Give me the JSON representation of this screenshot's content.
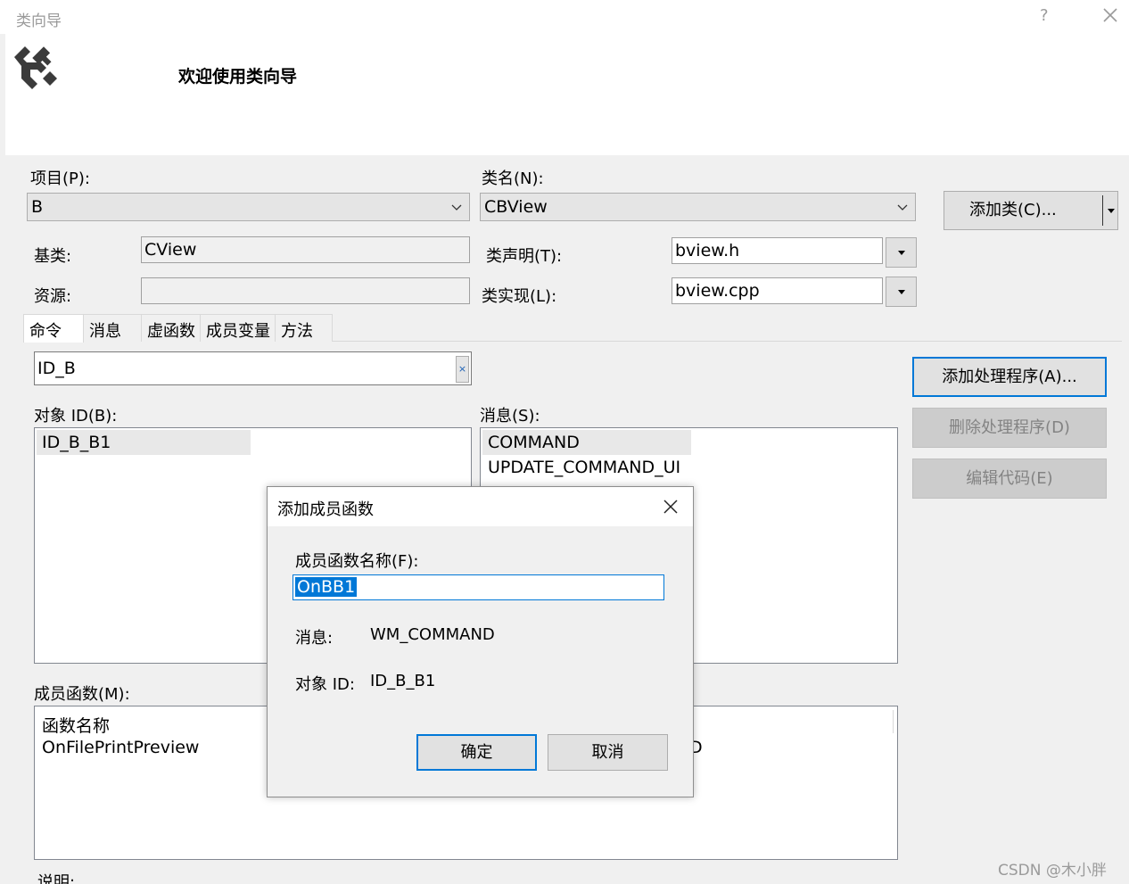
{
  "window": {
    "title": "类向导",
    "help_glyph": "?",
    "welcome": "欢迎使用类向导"
  },
  "project": {
    "label": "项目(P):",
    "value": "B"
  },
  "class_name": {
    "label": "类名(N):",
    "value": "CBView"
  },
  "add_class_button": "添加类(C)...",
  "base_class": {
    "label": "基类:",
    "value": "CView"
  },
  "resource": {
    "label": "资源:",
    "value": ""
  },
  "class_decl": {
    "label": "类声明(T):",
    "value": "bview.h"
  },
  "class_impl": {
    "label": "类实现(L):",
    "value": "bview.cpp"
  },
  "tabs": [
    "命令",
    "消息",
    "虚函数",
    "成员变量",
    "方法"
  ],
  "search": {
    "value": "ID_B",
    "clear_glyph": "×"
  },
  "object_ids": {
    "label": "对象 ID(B):",
    "items": [
      "ID_B_B1"
    ]
  },
  "messages": {
    "label": "消息(S):",
    "items": [
      "COMMAND",
      "UPDATE_COMMAND_UI"
    ]
  },
  "actions": {
    "add_handler": "添加处理程序(A)...",
    "delete_handler": "删除处理程序(D)",
    "edit_code": "编辑代码(E)"
  },
  "member_functions": {
    "label": "成员函数(M):",
    "header": "函数名称",
    "rows": [
      "OnFilePrintPreview"
    ],
    "partial_right": "D"
  },
  "description_label": "说明:",
  "watermark": "CSDN @木小胖",
  "dialog": {
    "title": "添加成员函数",
    "name_label": "成员函数名称(F):",
    "name_value": "OnBB1",
    "message_label": "消息:",
    "message_value": "WM_COMMAND",
    "object_label": "对象 ID:",
    "object_value": "ID_B_B1",
    "ok": "确定",
    "cancel": "取消"
  }
}
